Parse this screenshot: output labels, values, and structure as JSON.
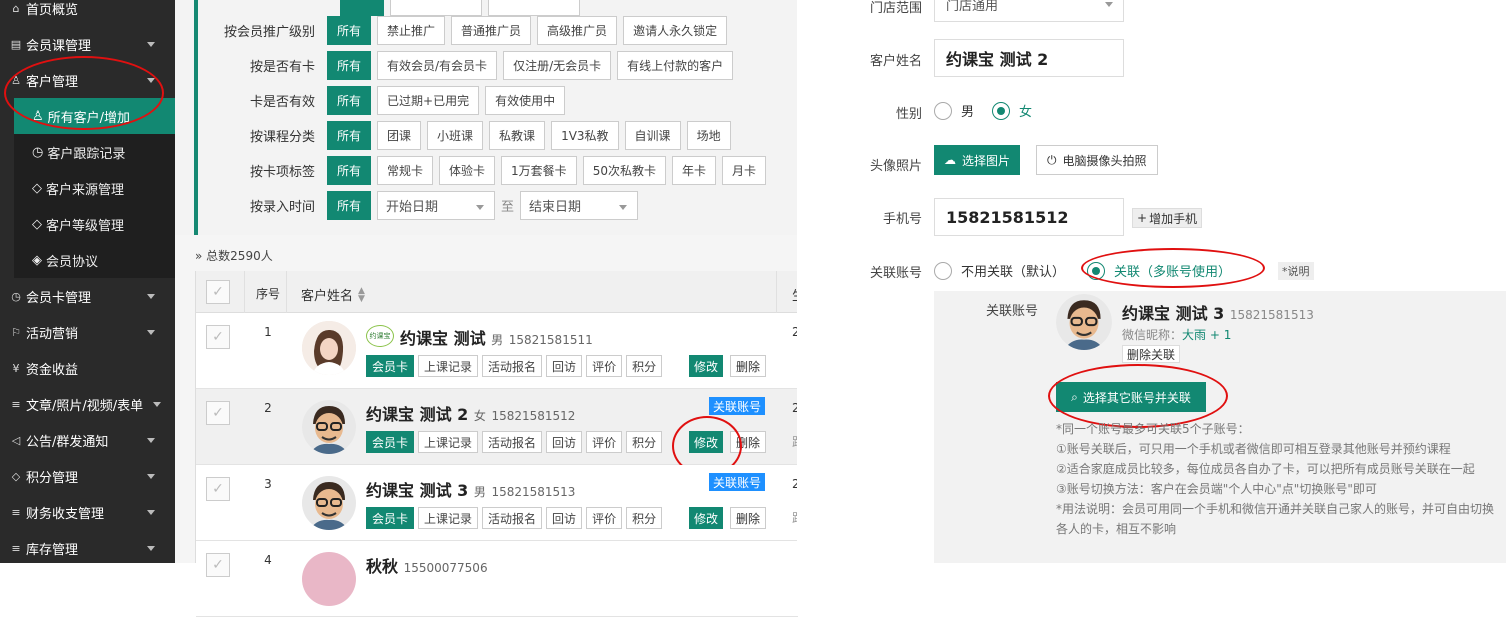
{
  "sidebar": {
    "items": [
      {
        "label": "首页概览",
        "icon": "home-icon"
      },
      {
        "label": "会员课管理",
        "icon": "document-icon"
      },
      {
        "label": "客户管理",
        "icon": "user-icon"
      },
      {
        "label": "会员卡管理",
        "icon": "clock-icon"
      },
      {
        "label": "活动营销",
        "icon": "flag-icon"
      },
      {
        "label": "资金收益",
        "icon": "money-icon"
      },
      {
        "label": "文章/照片/视频/表单",
        "icon": "sliders-icon"
      },
      {
        "label": "公告/群发通知",
        "icon": "speaker-icon"
      },
      {
        "label": "积分管理",
        "icon": "diamond-icon"
      },
      {
        "label": "财务收支管理",
        "icon": "sliders-icon"
      },
      {
        "label": "库存管理",
        "icon": "sliders-icon"
      }
    ],
    "sub_items": [
      {
        "label": "所有客户/增加",
        "icon": "user-icon"
      },
      {
        "label": "客户跟踪记录",
        "icon": "clock-icon"
      },
      {
        "label": "客户来源管理",
        "icon": "tag-icon"
      },
      {
        "label": "客户等级管理",
        "icon": "tag-icon"
      },
      {
        "label": "会员协议",
        "icon": "layers-icon"
      }
    ]
  },
  "filters": [
    {
      "label": "按会员推广级别",
      "options": [
        "所有",
        "禁止推广",
        "普通推广员",
        "高级推广员",
        "邀请人永久锁定"
      ]
    },
    {
      "label": "按是否有卡",
      "options": [
        "所有",
        "有效会员/有会员卡",
        "仅注册/无会员卡",
        "有线上付款的客户"
      ]
    },
    {
      "label": "卡是否有效",
      "options": [
        "所有",
        "已过期+已用完",
        "有效使用中"
      ]
    },
    {
      "label": "按课程分类",
      "options": [
        "所有",
        "团课",
        "小班课",
        "私教课",
        "1V3私教",
        "自训课",
        "场地"
      ]
    },
    {
      "label": "按卡项标签",
      "options": [
        "所有",
        "常规卡",
        "体验卡",
        "1万套餐卡",
        "50次私教卡",
        "年卡",
        "月卡"
      ]
    }
  ],
  "date_filter": {
    "label": "按录入时间",
    "all": "所有",
    "start": "开始日期",
    "to": "至",
    "end": "结束日期"
  },
  "list": {
    "total": "总数2590人",
    "headers": {
      "seq": "序号",
      "name": "客户姓名"
    },
    "partial_col": "生",
    "actions": [
      "会员卡",
      "上课记录",
      "活动报名",
      "回访",
      "评价",
      "积分"
    ],
    "modify": "修改",
    "delete": "删除",
    "assoc_badge": "关联账号",
    "rows": [
      {
        "seq": "1",
        "name": "约课宝 测试",
        "gender": "男",
        "phone": "15821581511",
        "logo": "约课宝",
        "edge": "2"
      },
      {
        "seq": "2",
        "name": "约课宝 测试 2",
        "gender": "女",
        "phone": "15821581512",
        "edge": "2",
        "edge2": "跟"
      },
      {
        "seq": "3",
        "name": "约课宝 测试 3",
        "gender": "男",
        "phone": "15821581513",
        "edge": "2",
        "edge2": "跟"
      },
      {
        "seq": "4",
        "name": "秋秋",
        "gender": "",
        "phone": "15500077506"
      }
    ]
  },
  "panel": {
    "store_label": "门店范围",
    "store_value": "门店通用",
    "name_label": "客户姓名",
    "name_value": "约课宝 测试 2",
    "gender_label": "性别",
    "gender_male": "男",
    "gender_female": "女",
    "photo_label": "头像照片",
    "choose_photo": "选择图片",
    "camera_photo": "电脑摄像头拍照",
    "phone_label": "手机号",
    "phone_value": "15821581512",
    "add_phone": "增加手机",
    "link_label": "关联账号",
    "no_link": "不用关联（默认）",
    "link": "关联（多账号使用）",
    "explain": "*说明",
    "linked_label": "关联账号",
    "linked_name": "约课宝 测试 3",
    "linked_phone": "15821581513",
    "wechat_label": "微信昵称：",
    "wechat_value": "大雨 + 1",
    "remove_link": "删除关联",
    "select_link": "选择其它账号并关联",
    "notes": [
      "*同一个账号最多可关联5个子账号：",
      "①账号关联后，可只用一个手机或者微信即可相互登录其他账号并预约课程",
      "②适合家庭成员比较多，每位成员各自办了卡，可以把所有成员账号关联在一起",
      "③账号切换方法：客户在会员端\"个人中心\"点\"切换账号\"即可",
      "*用法说明：会员可用同一个手机和微信开通并关联自己家人的账号，并可自由切换",
      "各人的卡，相互不影响"
    ]
  },
  "colors": {
    "primary": "#128872",
    "sidebar": "#2a2a2a",
    "badge": "#1e90ff",
    "highlight": "#e01010"
  }
}
